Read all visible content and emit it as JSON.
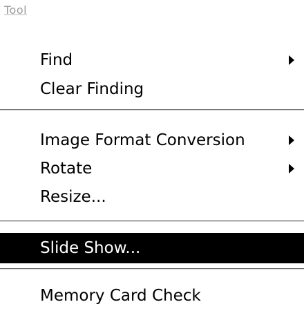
{
  "menu": {
    "title": "Tool",
    "items": [
      {
        "label": "Find",
        "has_submenu": true,
        "selected": false
      },
      {
        "label": "Clear Finding",
        "has_submenu": false,
        "selected": false
      },
      {
        "label": "Image Format Conversion",
        "has_submenu": true,
        "selected": false
      },
      {
        "label": "Rotate",
        "has_submenu": true,
        "selected": false
      },
      {
        "label": "Resize...",
        "has_submenu": false,
        "selected": false
      },
      {
        "label": "Slide Show...",
        "has_submenu": false,
        "selected": true
      },
      {
        "label": "Memory Card Check",
        "has_submenu": false,
        "selected": false
      }
    ]
  },
  "colors": {
    "background": "#ffffff",
    "text": "#000000",
    "selection_background": "#000000",
    "selection_text": "#ffffff",
    "disabled_title": "#9a9a9a"
  },
  "icons": {
    "submenu_arrow": "submenu-arrow-icon"
  }
}
